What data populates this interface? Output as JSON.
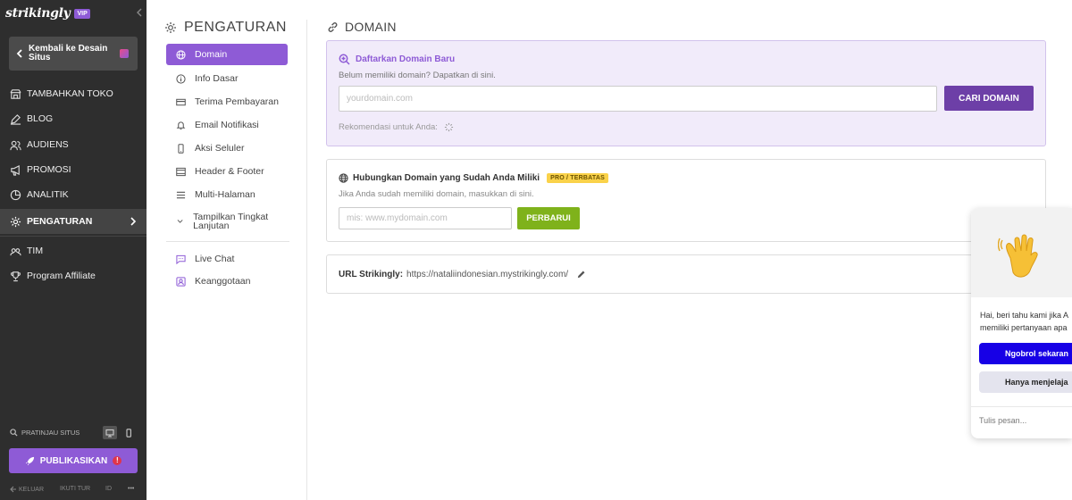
{
  "brand": {
    "logo": "strikingly",
    "plan_badge": "VIP"
  },
  "sidebar": {
    "back_label": "Kembali ke Desain Situs",
    "items": [
      {
        "label": "TAMBAHKAN TOKO",
        "icon": "store-icon"
      },
      {
        "label": "BLOG",
        "icon": "pen-icon"
      },
      {
        "label": "AUDIENS",
        "icon": "users-icon"
      },
      {
        "label": "PROMOSI",
        "icon": "megaphone-icon"
      },
      {
        "label": "ANALITIK",
        "icon": "pie-chart-icon"
      },
      {
        "label": "PENGATURAN",
        "icon": "gear-icon",
        "active": true
      },
      {
        "label": "TIM",
        "icon": "team-icon"
      },
      {
        "label": "Program Affiliate",
        "icon": "trophy-icon"
      }
    ],
    "preview_label": "PRATINJAU SITUS",
    "publish_label": "PUBLIKASIKAN",
    "publish_badge": "!",
    "footer": {
      "logout": "KELUAR",
      "tour": "IKUTI TUR",
      "lang": "ID",
      "more": "•••"
    }
  },
  "settings": {
    "title": "PENGATURAN",
    "menu": [
      {
        "label": "Domain",
        "icon": "globe-icon",
        "active": true
      },
      {
        "label": "Info Dasar",
        "icon": "info-icon"
      },
      {
        "label": "Terima Pembayaran",
        "icon": "credit-card-icon"
      },
      {
        "label": "Email Notifikasi",
        "icon": "bell-icon"
      },
      {
        "label": "Aksi Seluler",
        "icon": "mobile-icon"
      },
      {
        "label": "Header & Footer",
        "icon": "header-footer-icon"
      },
      {
        "label": "Multi-Halaman",
        "icon": "pages-icon"
      },
      {
        "label": "Tampilkan Tingkat Lanjutan",
        "icon": "chevron-down-icon"
      },
      {
        "label": "Live Chat",
        "icon": "chat-icon"
      },
      {
        "label": "Keanggotaan",
        "icon": "membership-icon"
      }
    ]
  },
  "domain": {
    "title": "DOMAIN",
    "register": {
      "title": "Daftarkan Domain Baru",
      "subtitle": "Belum memiliki domain? Dapatkan di sini.",
      "placeholder": "yourdomain.com",
      "button": "CARI DOMAIN",
      "recommend": "Rekomendasi untuk Anda:"
    },
    "connect": {
      "title": "Hubungkan Domain yang Sudah Anda Miliki",
      "badge": "PRO / TERBATAS",
      "subtitle": "Jika Anda sudah memiliki domain, masukkan di sini.",
      "placeholder": "mis: www.mydomain.com",
      "button": "PERBARUI"
    },
    "url": {
      "label": "URL Strikingly:",
      "value": "https://nataliindonesian.mystrikingly.com/"
    }
  },
  "chat": {
    "emoji": "👋",
    "message_line1": "Hai, beri tahu kami jika A",
    "message_line2": "memiliki pertanyaan apa",
    "button_primary": "Ngobrol sekaran",
    "button_secondary": "Hanya menjelaja",
    "input_placeholder": "Tulis pesan..."
  },
  "colors": {
    "sidebar_bg": "#2e2e2e",
    "accent": "#8e5bd6",
    "cta_dark": "#6d3fa7",
    "update_green": "#7fb21b",
    "pro_badge": "#fad24a",
    "chat_blue": "#1700e6"
  }
}
